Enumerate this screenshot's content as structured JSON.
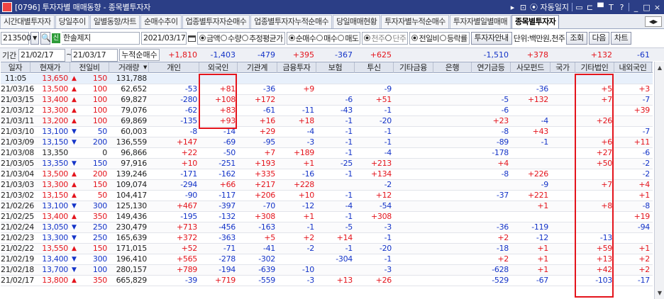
{
  "window": {
    "title": "[0796] 투자자별 매매동향 - 종목별투자자",
    "controls": [
      "▸",
      "⊡",
      "⦿ 자동일지",
      "▭",
      "⊏",
      "▀",
      "T",
      "?",
      "_",
      "□",
      "×"
    ]
  },
  "tabs": [
    {
      "label": "시간대별투자자",
      "active": false
    },
    {
      "label": "당일추이",
      "active": false
    },
    {
      "label": "일별동향/차트",
      "active": false
    },
    {
      "label": "순매수추이",
      "active": false
    },
    {
      "label": "업종별투자자순매수",
      "active": false
    },
    {
      "label": "업종별투자자누적순매수",
      "active": false
    },
    {
      "label": "당일매매현황",
      "active": false
    },
    {
      "label": "투자자별누적순매수",
      "active": false
    },
    {
      "label": "투자자별일별매매",
      "active": false
    },
    {
      "label": "종목별투자자",
      "active": true
    }
  ],
  "toolbar": {
    "code": "213500",
    "stock_name": "한솔제지",
    "date": "2021/03/17",
    "radio1": [
      {
        "label": "금액",
        "on": true
      },
      {
        "label": "수량",
        "on": false
      },
      {
        "label": "추정평균가",
        "on": false
      }
    ],
    "radio2": [
      {
        "label": "순매수",
        "on": true
      },
      {
        "label": "매수",
        "on": false
      },
      {
        "label": "매도",
        "on": false
      }
    ],
    "radio3": [
      {
        "label": "천주",
        "on": true
      },
      {
        "label": "단주",
        "on": false
      }
    ],
    "radio4": [
      {
        "label": "전일비",
        "on": true
      },
      {
        "label": "등락률",
        "on": false
      }
    ],
    "guide_btn": "투자자안내",
    "unit": "단위:백만원,천주",
    "query_btn": "조회",
    "next_btn": "다음",
    "chart_btn": "차트"
  },
  "period": {
    "label": "기간",
    "from": "21/02/17",
    "to": "21/03/17",
    "total_label": "누적순매수",
    "sums": [
      {
        "col": 4,
        "v": "+1,810",
        "cls": "red"
      },
      {
        "col": 5,
        "v": "-1,403",
        "cls": "blue"
      },
      {
        "col": 6,
        "v": "-479",
        "cls": "blue"
      },
      {
        "col": 7,
        "v": "+395",
        "cls": "red"
      },
      {
        "col": 8,
        "v": "-367",
        "cls": "blue"
      },
      {
        "col": 9,
        "v": "+625",
        "cls": "red"
      },
      {
        "col": 12,
        "v": "-1,510",
        "cls": "blue"
      },
      {
        "col": 13,
        "v": "+378",
        "cls": "red"
      },
      {
        "col": 15,
        "v": "+132",
        "cls": "red"
      },
      {
        "col": 16,
        "v": "-61",
        "cls": "blue"
      }
    ]
  },
  "headers": [
    "일자",
    "현재가",
    "전일비",
    "거래량",
    "개인",
    "외국인",
    "기관계",
    "금융투자",
    "보험",
    "투신",
    "기타금융",
    "은행",
    "연기금등",
    "사모펀드",
    "국가",
    "기타법인",
    "내외국인"
  ],
  "rows": [
    {
      "hl": true,
      "d": [
        "11:05",
        "13,650",
        "150",
        "131,788",
        "",
        "",
        "",
        "",
        "",
        "",
        "",
        "",
        "",
        "",
        "",
        "",
        ""
      ],
      "dir": "up"
    },
    {
      "d": [
        "21/03/16",
        "13,500",
        "100",
        "62,652",
        "-53",
        "+81",
        "-36",
        "+9",
        "",
        "-9",
        "",
        "",
        "",
        "-36",
        "",
        "+5",
        "+3"
      ],
      "dir": "up"
    },
    {
      "d": [
        "21/03/15",
        "13,400",
        "100",
        "69,827",
        "-280",
        "+108",
        "+172",
        "",
        "-6",
        "+51",
        "",
        "",
        "-5",
        "+132",
        "",
        "+7",
        "-7"
      ],
      "dir": "up"
    },
    {
      "d": [
        "21/03/12",
        "13,300",
        "100",
        "79,076",
        "-62",
        "+83",
        "-61",
        "-11",
        "-43",
        "-1",
        "",
        "",
        "-6",
        "",
        "",
        "",
        "+39"
      ],
      "dir": "up"
    },
    {
      "d": [
        "21/03/11",
        "13,200",
        "100",
        "69,869",
        "-135",
        "+93",
        "+16",
        "+18",
        "-1",
        "-20",
        "",
        "",
        "+23",
        "-4",
        "",
        "+26",
        ""
      ],
      "dir": "up"
    },
    {
      "d": [
        "21/03/10",
        "13,100",
        "50",
        "60,003",
        "-8",
        "-14",
        "+29",
        "-4",
        "-1",
        "-1",
        "",
        "",
        "-8",
        "+43",
        "",
        "",
        "-7"
      ],
      "dir": "dn"
    },
    {
      "d": [
        "21/03/09",
        "13,150",
        "200",
        "136,559",
        "+147",
        "-69",
        "-95",
        "-3",
        "-1",
        "-1",
        "",
        "",
        "-89",
        "-1",
        "",
        "+6",
        "+11"
      ],
      "dir": "dn"
    },
    {
      "d": [
        "21/03/08",
        "13,350",
        "0",
        "96,866",
        "+22",
        "-50",
        "+7",
        "+189",
        "-1",
        "-4",
        "",
        "",
        "-178",
        "",
        "",
        "+27",
        "-6"
      ],
      "dir": "none"
    },
    {
      "d": [
        "21/03/05",
        "13,350",
        "150",
        "97,916",
        "+10",
        "-251",
        "+193",
        "+1",
        "-25",
        "+213",
        "",
        "",
        "+4",
        "",
        "",
        "+50",
        "-2"
      ],
      "dir": "dn"
    },
    {
      "d": [
        "21/03/04",
        "13,500",
        "200",
        "139,246",
        "-171",
        "-162",
        "+335",
        "-16",
        "-1",
        "+134",
        "",
        "",
        "-8",
        "+226",
        "",
        "",
        "-2"
      ],
      "dir": "up"
    },
    {
      "d": [
        "21/03/03",
        "13,300",
        "150",
        "109,074",
        "-294",
        "+66",
        "+217",
        "+228",
        "",
        "-2",
        "",
        "",
        "",
        "-9",
        "",
        "+7",
        "+4"
      ],
      "dir": "up"
    },
    {
      "d": [
        "21/03/02",
        "13,150",
        "50",
        "104,417",
        "-90",
        "-117",
        "+206",
        "+10",
        "-1",
        "+12",
        "",
        "",
        "-37",
        "+221",
        "",
        "",
        "+1"
      ],
      "dir": "up"
    },
    {
      "d": [
        "21/02/26",
        "13,100",
        "300",
        "125,130",
        "+467",
        "-397",
        "-70",
        "-12",
        "-4",
        "-54",
        "",
        "",
        "",
        "+1",
        "",
        "+8",
        "-8"
      ],
      "dir": "dn"
    },
    {
      "d": [
        "21/02/25",
        "13,400",
        "350",
        "149,436",
        "-195",
        "-132",
        "+308",
        "+1",
        "-1",
        "+308",
        "",
        "",
        "",
        "",
        "",
        "",
        "+19"
      ],
      "dir": "up"
    },
    {
      "d": [
        "21/02/24",
        "13,050",
        "250",
        "230,479",
        "+713",
        "-456",
        "-163",
        "-1",
        "-5",
        "-3",
        "",
        "",
        "-36",
        "-119",
        "",
        "",
        "-94"
      ],
      "dir": "dn"
    },
    {
      "d": [
        "21/02/23",
        "13,300",
        "250",
        "165,639",
        "+372",
        "-363",
        "+5",
        "+2",
        "+14",
        "-1",
        "",
        "",
        "+2",
        "-12",
        "",
        "-13",
        ""
      ],
      "dir": "dn"
    },
    {
      "d": [
        "21/02/22",
        "13,550",
        "150",
        "171,015",
        "+52",
        "-71",
        "-41",
        "-2",
        "-1",
        "-20",
        "",
        "",
        "-18",
        "+1",
        "",
        "+59",
        "+1"
      ],
      "dir": "up"
    },
    {
      "d": [
        "21/02/19",
        "13,400",
        "300",
        "196,410",
        "+565",
        "-278",
        "-302",
        "",
        "-304",
        "-1",
        "",
        "",
        "+2",
        "+1",
        "",
        "+13",
        "+2"
      ],
      "dir": "dn"
    },
    {
      "d": [
        "21/02/18",
        "13,700",
        "100",
        "280,157",
        "+789",
        "-194",
        "-639",
        "-10",
        "",
        "-3",
        "",
        "",
        "-628",
        "+1",
        "",
        "+42",
        "+2"
      ],
      "dir": "dn"
    },
    {
      "d": [
        "21/02/17",
        "13,800",
        "350",
        "665,829",
        "-39",
        "+719",
        "-559",
        "-3",
        "+13",
        "+26",
        "",
        "",
        "-529",
        "-67",
        "",
        "-103",
        "-17"
      ],
      "dir": "up"
    }
  ]
}
